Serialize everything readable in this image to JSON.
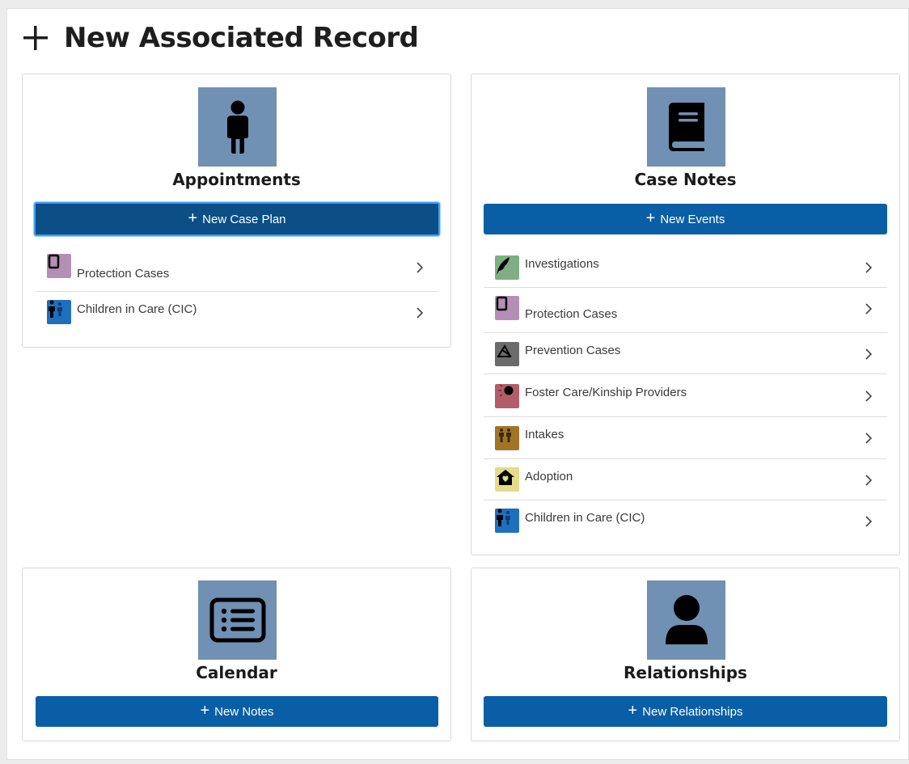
{
  "header": {
    "title": "New Associated Record"
  },
  "cards": {
    "appointments": {
      "title": "Appointments",
      "tile_icon": "child-icon",
      "button_label": "New Case Plan",
      "items": [
        {
          "label": "Protection Cases",
          "icon": "tablet-icon",
          "color": "#b48fb5"
        },
        {
          "label": "Children in Care (CIC)",
          "icon": "children-icon",
          "color": "#1f6fbf"
        }
      ]
    },
    "case_notes": {
      "title": "Case Notes",
      "tile_icon": "book-icon",
      "button_label": "New Events",
      "items": [
        {
          "label": "Investigations",
          "icon": "feather-icon",
          "color": "#7fae84"
        },
        {
          "label": "Protection Cases",
          "icon": "tablet-icon",
          "color": "#b48fb5"
        },
        {
          "label": "Prevention Cases",
          "icon": "triangle-icon",
          "color": "#6b6b6b"
        },
        {
          "label": "Foster Care/Kinship Providers",
          "icon": "sun-icon",
          "color": "#b35c6a"
        },
        {
          "label": "Intakes",
          "icon": "people-icon",
          "color": "#a07526"
        },
        {
          "label": "Adoption",
          "icon": "home-heart-icon",
          "color": "#e3dc8a"
        },
        {
          "label": "Children in Care (CIC)",
          "icon": "children-icon",
          "color": "#1f6fbf"
        }
      ]
    },
    "calendar": {
      "title": "Calendar",
      "tile_icon": "list-icon",
      "button_label": "New Notes"
    },
    "relationships": {
      "title": "Relationships",
      "tile_icon": "person-icon",
      "button_label": "New Relationships"
    }
  },
  "colors": {
    "button": "#0a5ea6",
    "button_focused": "#0b4f86",
    "tile": "#7090b4"
  }
}
